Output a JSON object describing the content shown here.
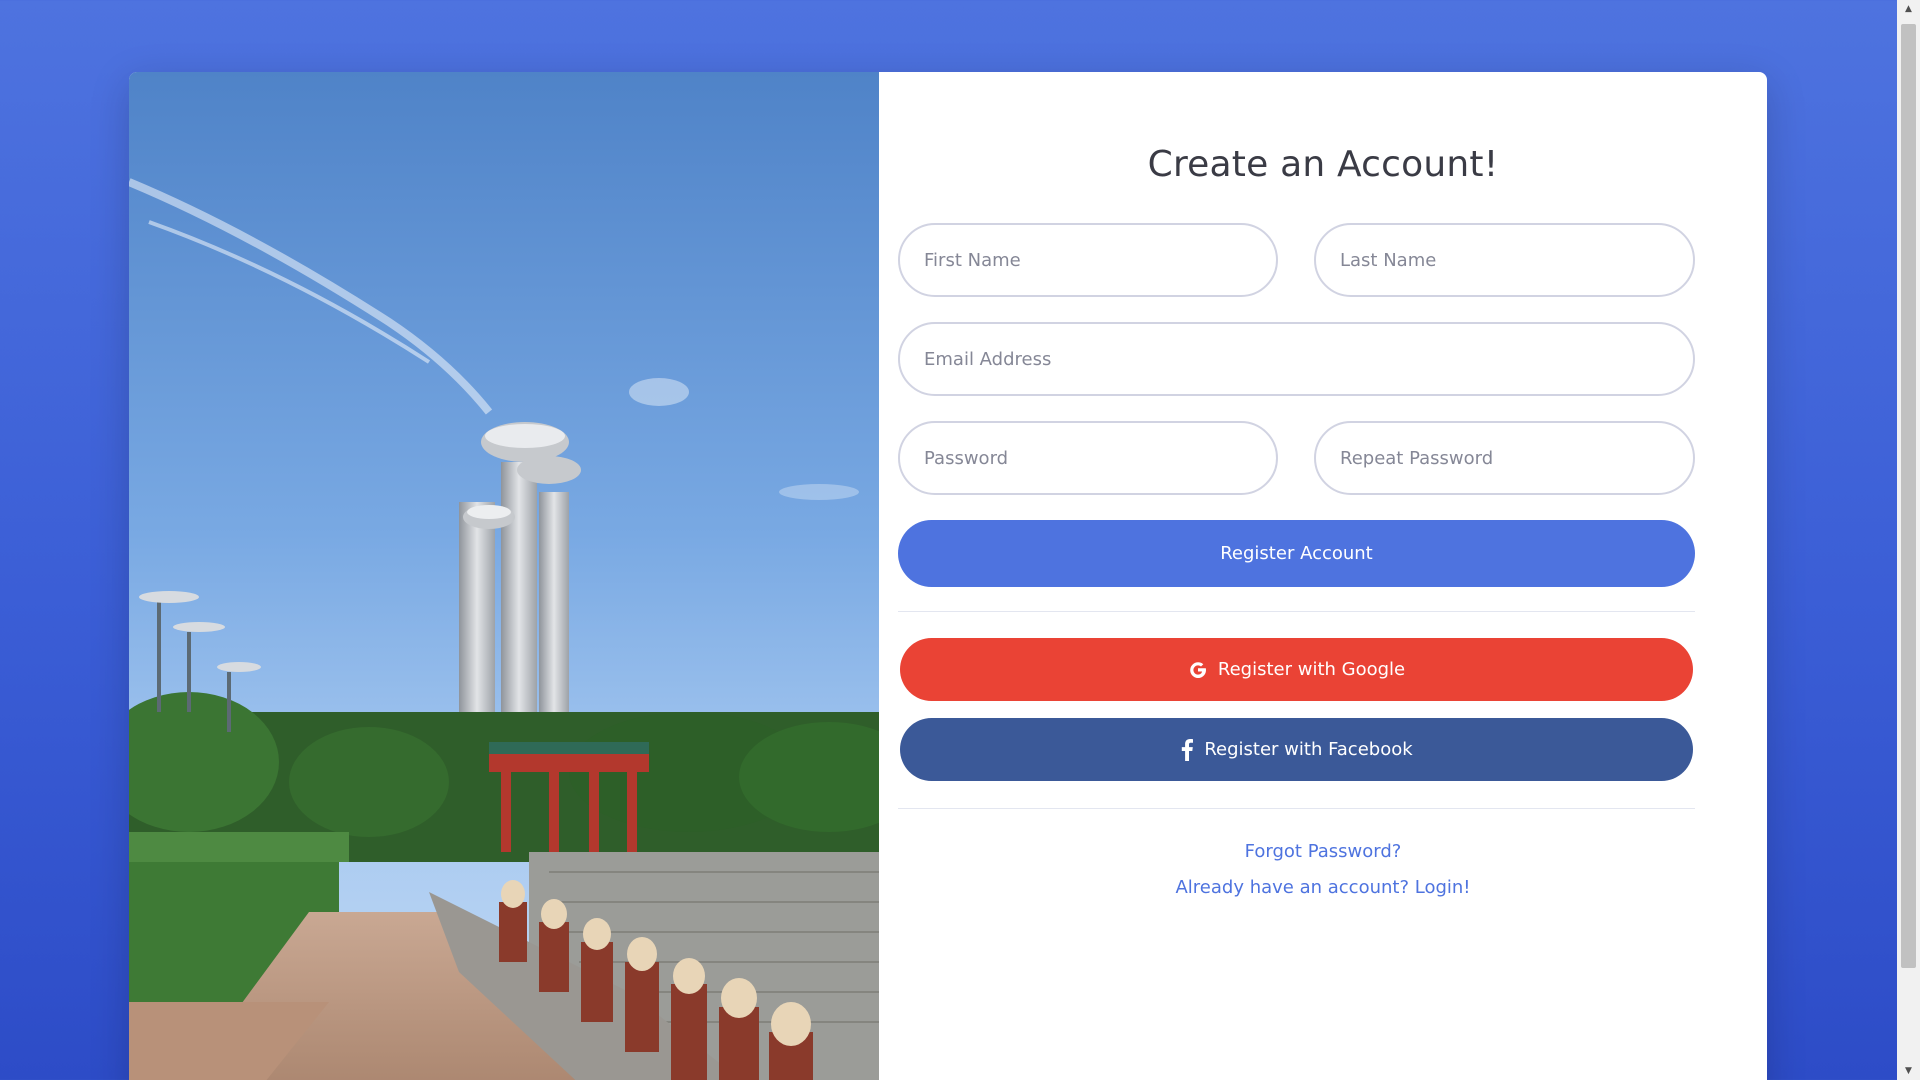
{
  "form": {
    "title": "Create an Account!",
    "first_name_placeholder": "First Name",
    "last_name_placeholder": "Last Name",
    "email_placeholder": "Email Address",
    "password_placeholder": "Password",
    "repeat_password_placeholder": "Repeat Password",
    "register_label": "Register Account",
    "google_label": "Register with Google",
    "facebook_label": "Register with Facebook",
    "forgot_password_link": "Forgot Password?",
    "login_link": "Already have an account? Login!"
  },
  "icons": {
    "google": "google-icon",
    "facebook": "facebook-icon",
    "scroll_up": "scroll-up-arrow-icon",
    "scroll_down": "scroll-down-arrow-icon"
  },
  "colors": {
    "background": "#4e73df",
    "primary": "#4e73df",
    "google": "#ea4335",
    "facebook": "#3b5998",
    "title": "#3a3b45",
    "link": "#4e73df"
  },
  "scroll": {
    "glyph_up": "▲",
    "glyph_down": "▼"
  }
}
